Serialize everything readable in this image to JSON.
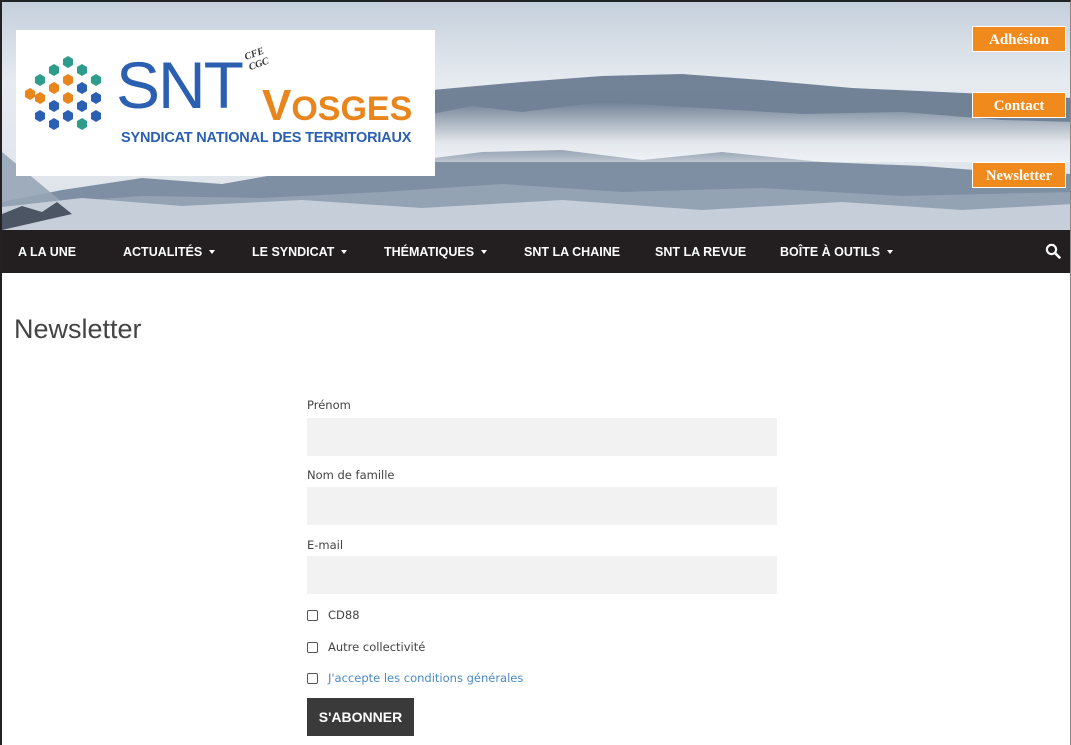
{
  "logo": {
    "brand": "SNT",
    "region_first": "V",
    "region_rest": "OSGES",
    "tagline": "SYNDICAT NATIONAL DES TERRITORIAUX",
    "union_line1": "CFE",
    "union_line2": "CGC"
  },
  "header_buttons": {
    "adhesion": "Adhésion",
    "contact": "Contact",
    "newsletter": "Newsletter"
  },
  "nav": {
    "items": [
      {
        "label": "A LA UNE"
      },
      {
        "label": "ACTUALITÉS"
      },
      {
        "label": "LE SYNDICAT"
      },
      {
        "label": "THÉMATIQUES"
      },
      {
        "label": "SNT LA CHAINE"
      },
      {
        "label": "SNT LA REVUE"
      },
      {
        "label": "BOÎTE À OUTILS"
      }
    ]
  },
  "page": {
    "title": "Newsletter"
  },
  "form": {
    "first_name_label": "Prénom",
    "first_name_value": "",
    "last_name_label": "Nom de famille",
    "last_name_value": "",
    "email_label": "E-mail",
    "email_value": "",
    "options": [
      {
        "label": "CD88",
        "checked": false
      },
      {
        "label": "Autre collectivité",
        "checked": false
      }
    ],
    "terms_label": "J'accepte les conditions générales",
    "submit_label": "S'ABONNER"
  },
  "colors": {
    "accent_orange": "#f08a1d",
    "brand_blue": "#2b5fb1",
    "nav_bg": "#231f20",
    "link_blue": "#4a8ac4"
  }
}
